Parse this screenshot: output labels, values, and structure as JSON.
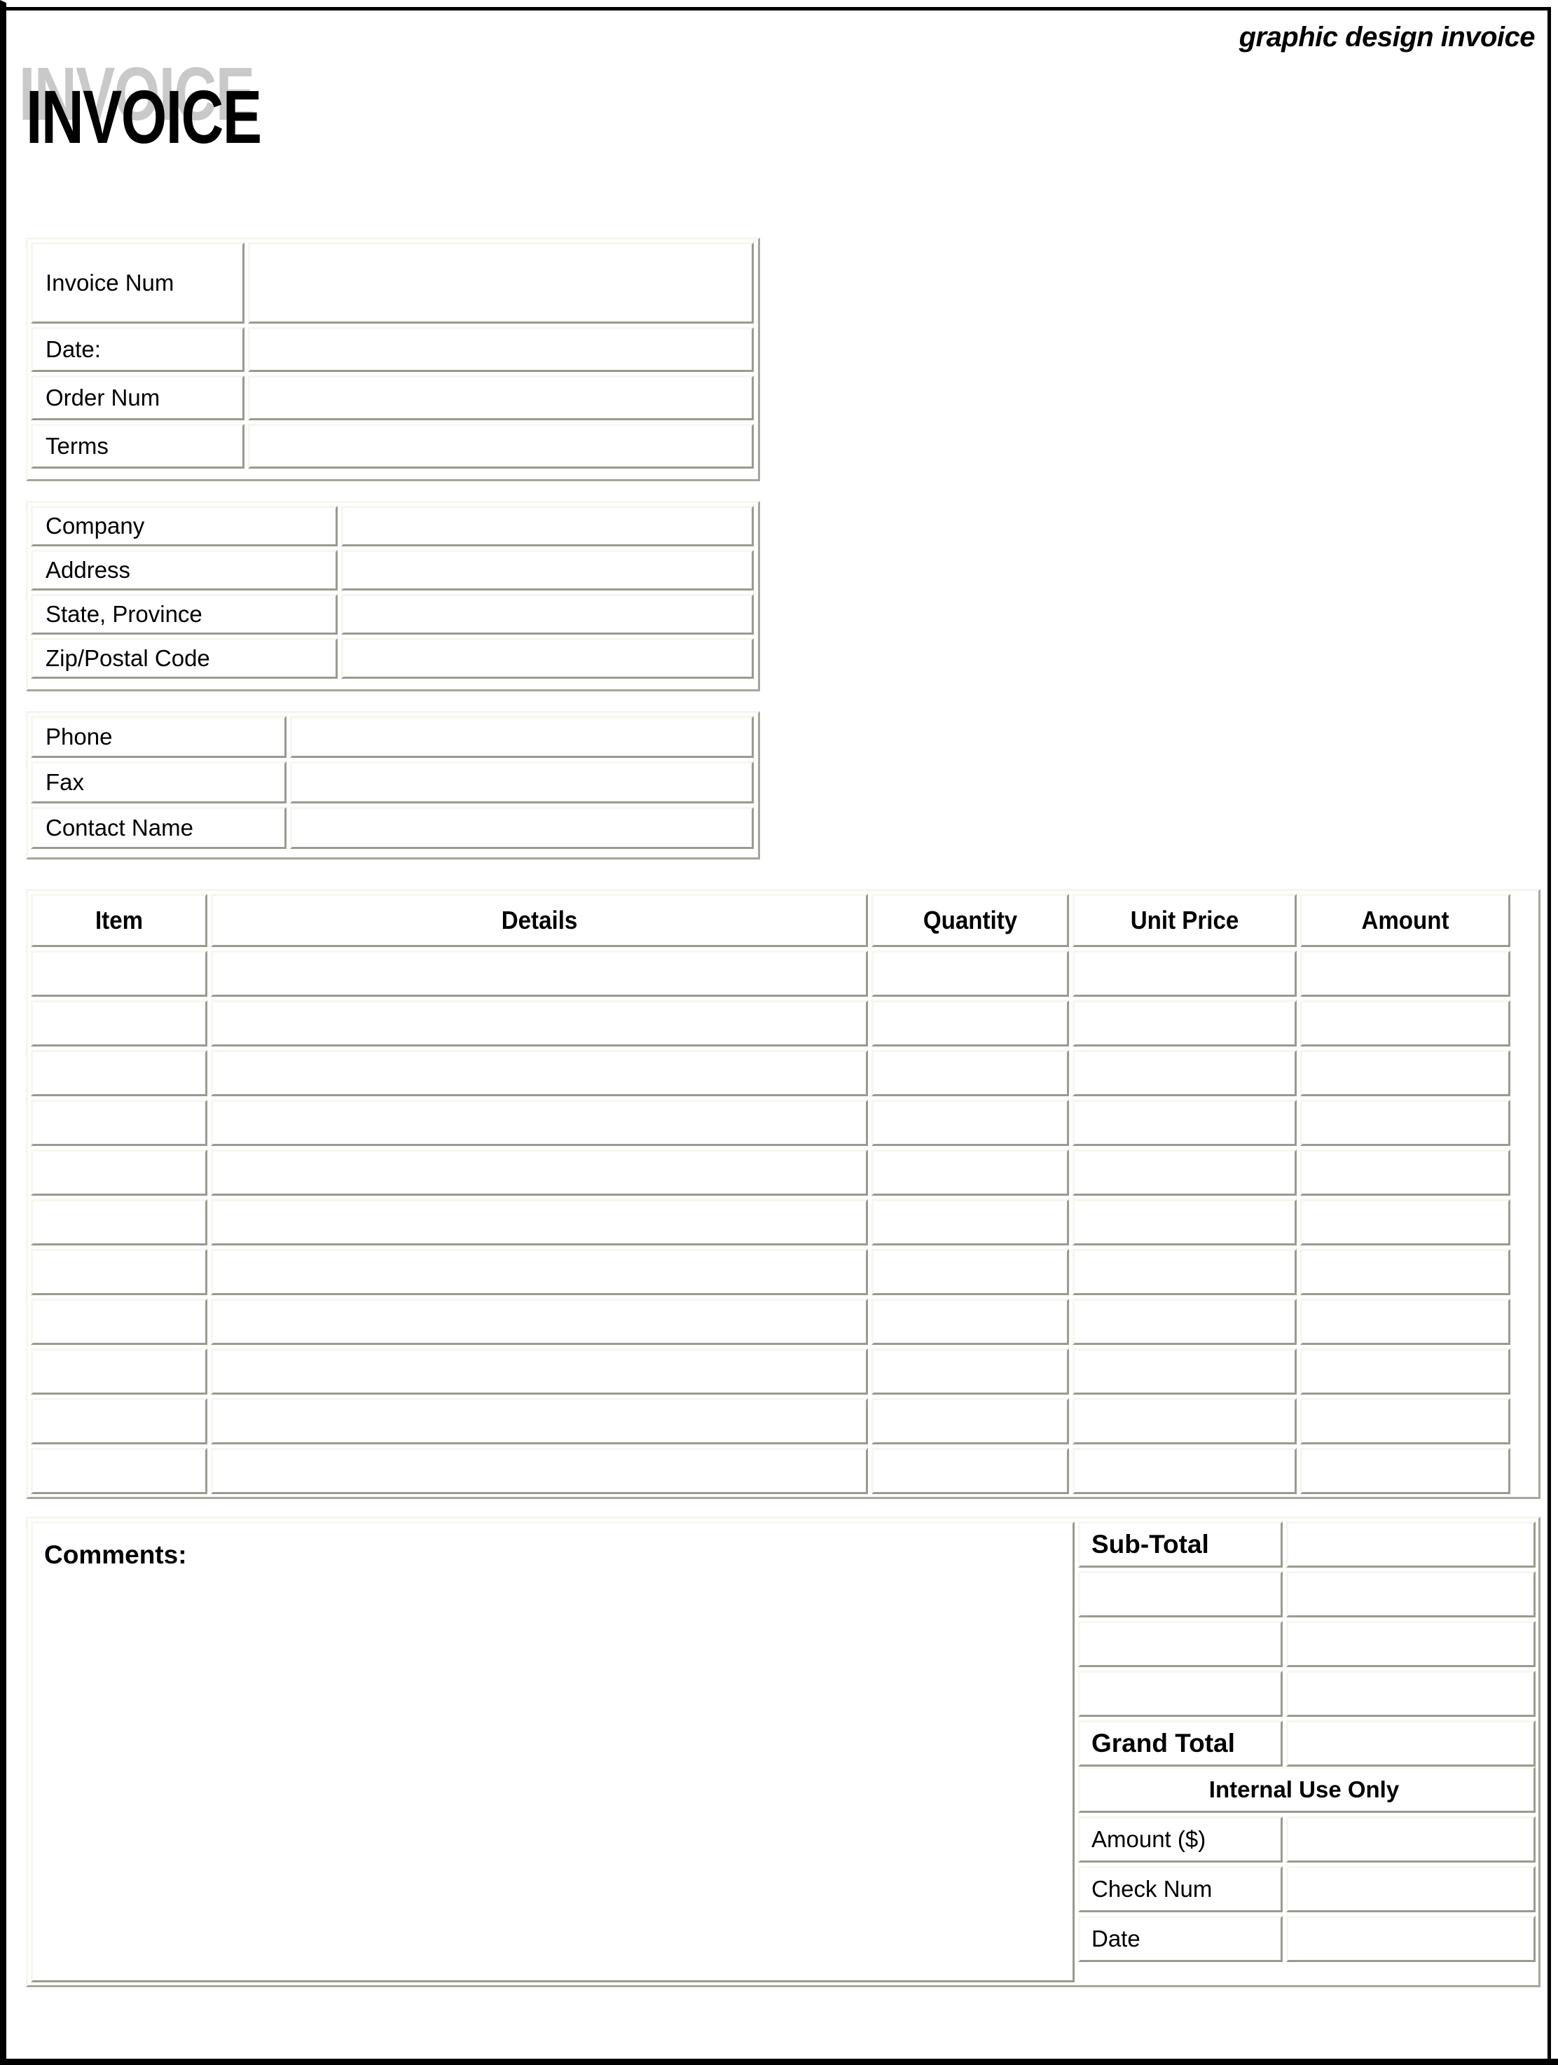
{
  "header": {
    "tagline": "graphic design invoice",
    "title": "INVOICE"
  },
  "invoice_block": {
    "rows": [
      {
        "label": "Invoice Num",
        "value": ""
      },
      {
        "label": "Date:",
        "value": ""
      },
      {
        "label": "Order Num",
        "value": ""
      },
      {
        "label": "Terms",
        "value": ""
      }
    ]
  },
  "company_block": {
    "rows": [
      {
        "label": "Company",
        "value": ""
      },
      {
        "label": "Address",
        "value": ""
      },
      {
        "label": "State, Province",
        "value": ""
      },
      {
        "label": "Zip/Postal Code",
        "value": ""
      }
    ]
  },
  "contact_block": {
    "rows": [
      {
        "label": "Phone",
        "value": ""
      },
      {
        "label": "Fax",
        "value": ""
      },
      {
        "label": "Contact Name",
        "value": ""
      }
    ]
  },
  "items_table": {
    "columns": [
      "Item",
      "Details",
      "Quantity",
      "Unit Price",
      "Amount"
    ],
    "rows": [
      {
        "item": "",
        "details": "",
        "quantity": "",
        "unit_price": "",
        "amount": ""
      },
      {
        "item": "",
        "details": "",
        "quantity": "",
        "unit_price": "",
        "amount": ""
      },
      {
        "item": "",
        "details": "",
        "quantity": "",
        "unit_price": "",
        "amount": ""
      },
      {
        "item": "",
        "details": "",
        "quantity": "",
        "unit_price": "",
        "amount": ""
      },
      {
        "item": "",
        "details": "",
        "quantity": "",
        "unit_price": "",
        "amount": ""
      },
      {
        "item": "",
        "details": "",
        "quantity": "",
        "unit_price": "",
        "amount": ""
      },
      {
        "item": "",
        "details": "",
        "quantity": "",
        "unit_price": "",
        "amount": ""
      },
      {
        "item": "",
        "details": "",
        "quantity": "",
        "unit_price": "",
        "amount": ""
      },
      {
        "item": "",
        "details": "",
        "quantity": "",
        "unit_price": "",
        "amount": ""
      },
      {
        "item": "",
        "details": "",
        "quantity": "",
        "unit_price": "",
        "amount": ""
      },
      {
        "item": "",
        "details": "",
        "quantity": "",
        "unit_price": "",
        "amount": ""
      }
    ]
  },
  "comments": {
    "label": "Comments:",
    "value": ""
  },
  "totals": {
    "rows": [
      {
        "label": "Sub-Total",
        "value": "",
        "bold": true
      },
      {
        "label": "",
        "value": "",
        "bold": false
      },
      {
        "label": "",
        "value": "",
        "bold": false
      },
      {
        "label": "",
        "value": "",
        "bold": false
      },
      {
        "label": "Grand Total",
        "value": "",
        "bold": true
      }
    ]
  },
  "internal_use": {
    "heading": "Internal Use Only",
    "rows": [
      {
        "label": "Amount ($)",
        "value": ""
      },
      {
        "label": "Check Num",
        "value": ""
      },
      {
        "label": "Date",
        "value": ""
      }
    ]
  },
  "colors": {
    "page_border": "#000000",
    "cell_highlight": "#f7f7f0",
    "cell_shadow": "#9a9a90",
    "title_shadow": "#c9c9c9",
    "text": "#000000"
  }
}
